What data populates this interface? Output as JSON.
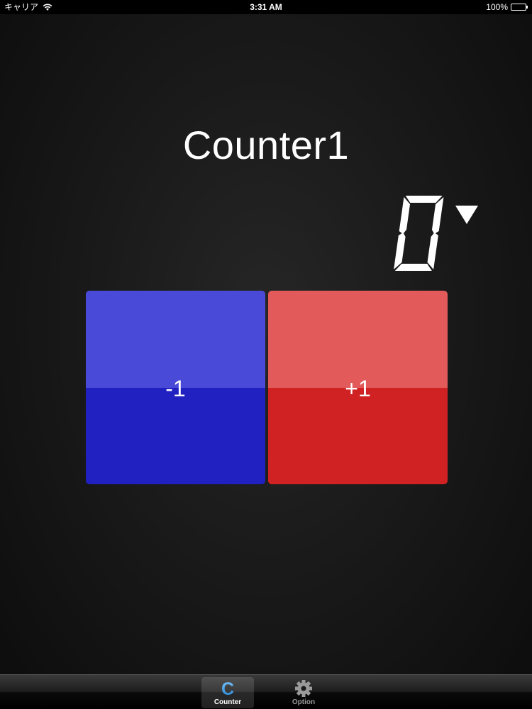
{
  "status_bar": {
    "carrier": "キャリア",
    "time": "3:31 AM",
    "battery": "100%",
    "wifi_icon": "wifi-icon",
    "battery_icon": "battery-icon"
  },
  "counter": {
    "title": "Counter1",
    "value": 0,
    "dropdown_icon": "triangle-down-icon"
  },
  "buttons": {
    "decrement_label": "-1",
    "increment_label": "+1",
    "decrement_colors": {
      "top": "#4a4ad8",
      "bottom": "#2121c2"
    },
    "increment_colors": {
      "top": "#e35a5a",
      "bottom": "#d02222"
    }
  },
  "tab_bar": {
    "tabs": [
      {
        "label": "Counter",
        "icon": "c-letter-icon",
        "selected": true,
        "accent": "#3aa0e8"
      },
      {
        "label": "Option",
        "icon": "gear-icon",
        "selected": false
      }
    ]
  }
}
